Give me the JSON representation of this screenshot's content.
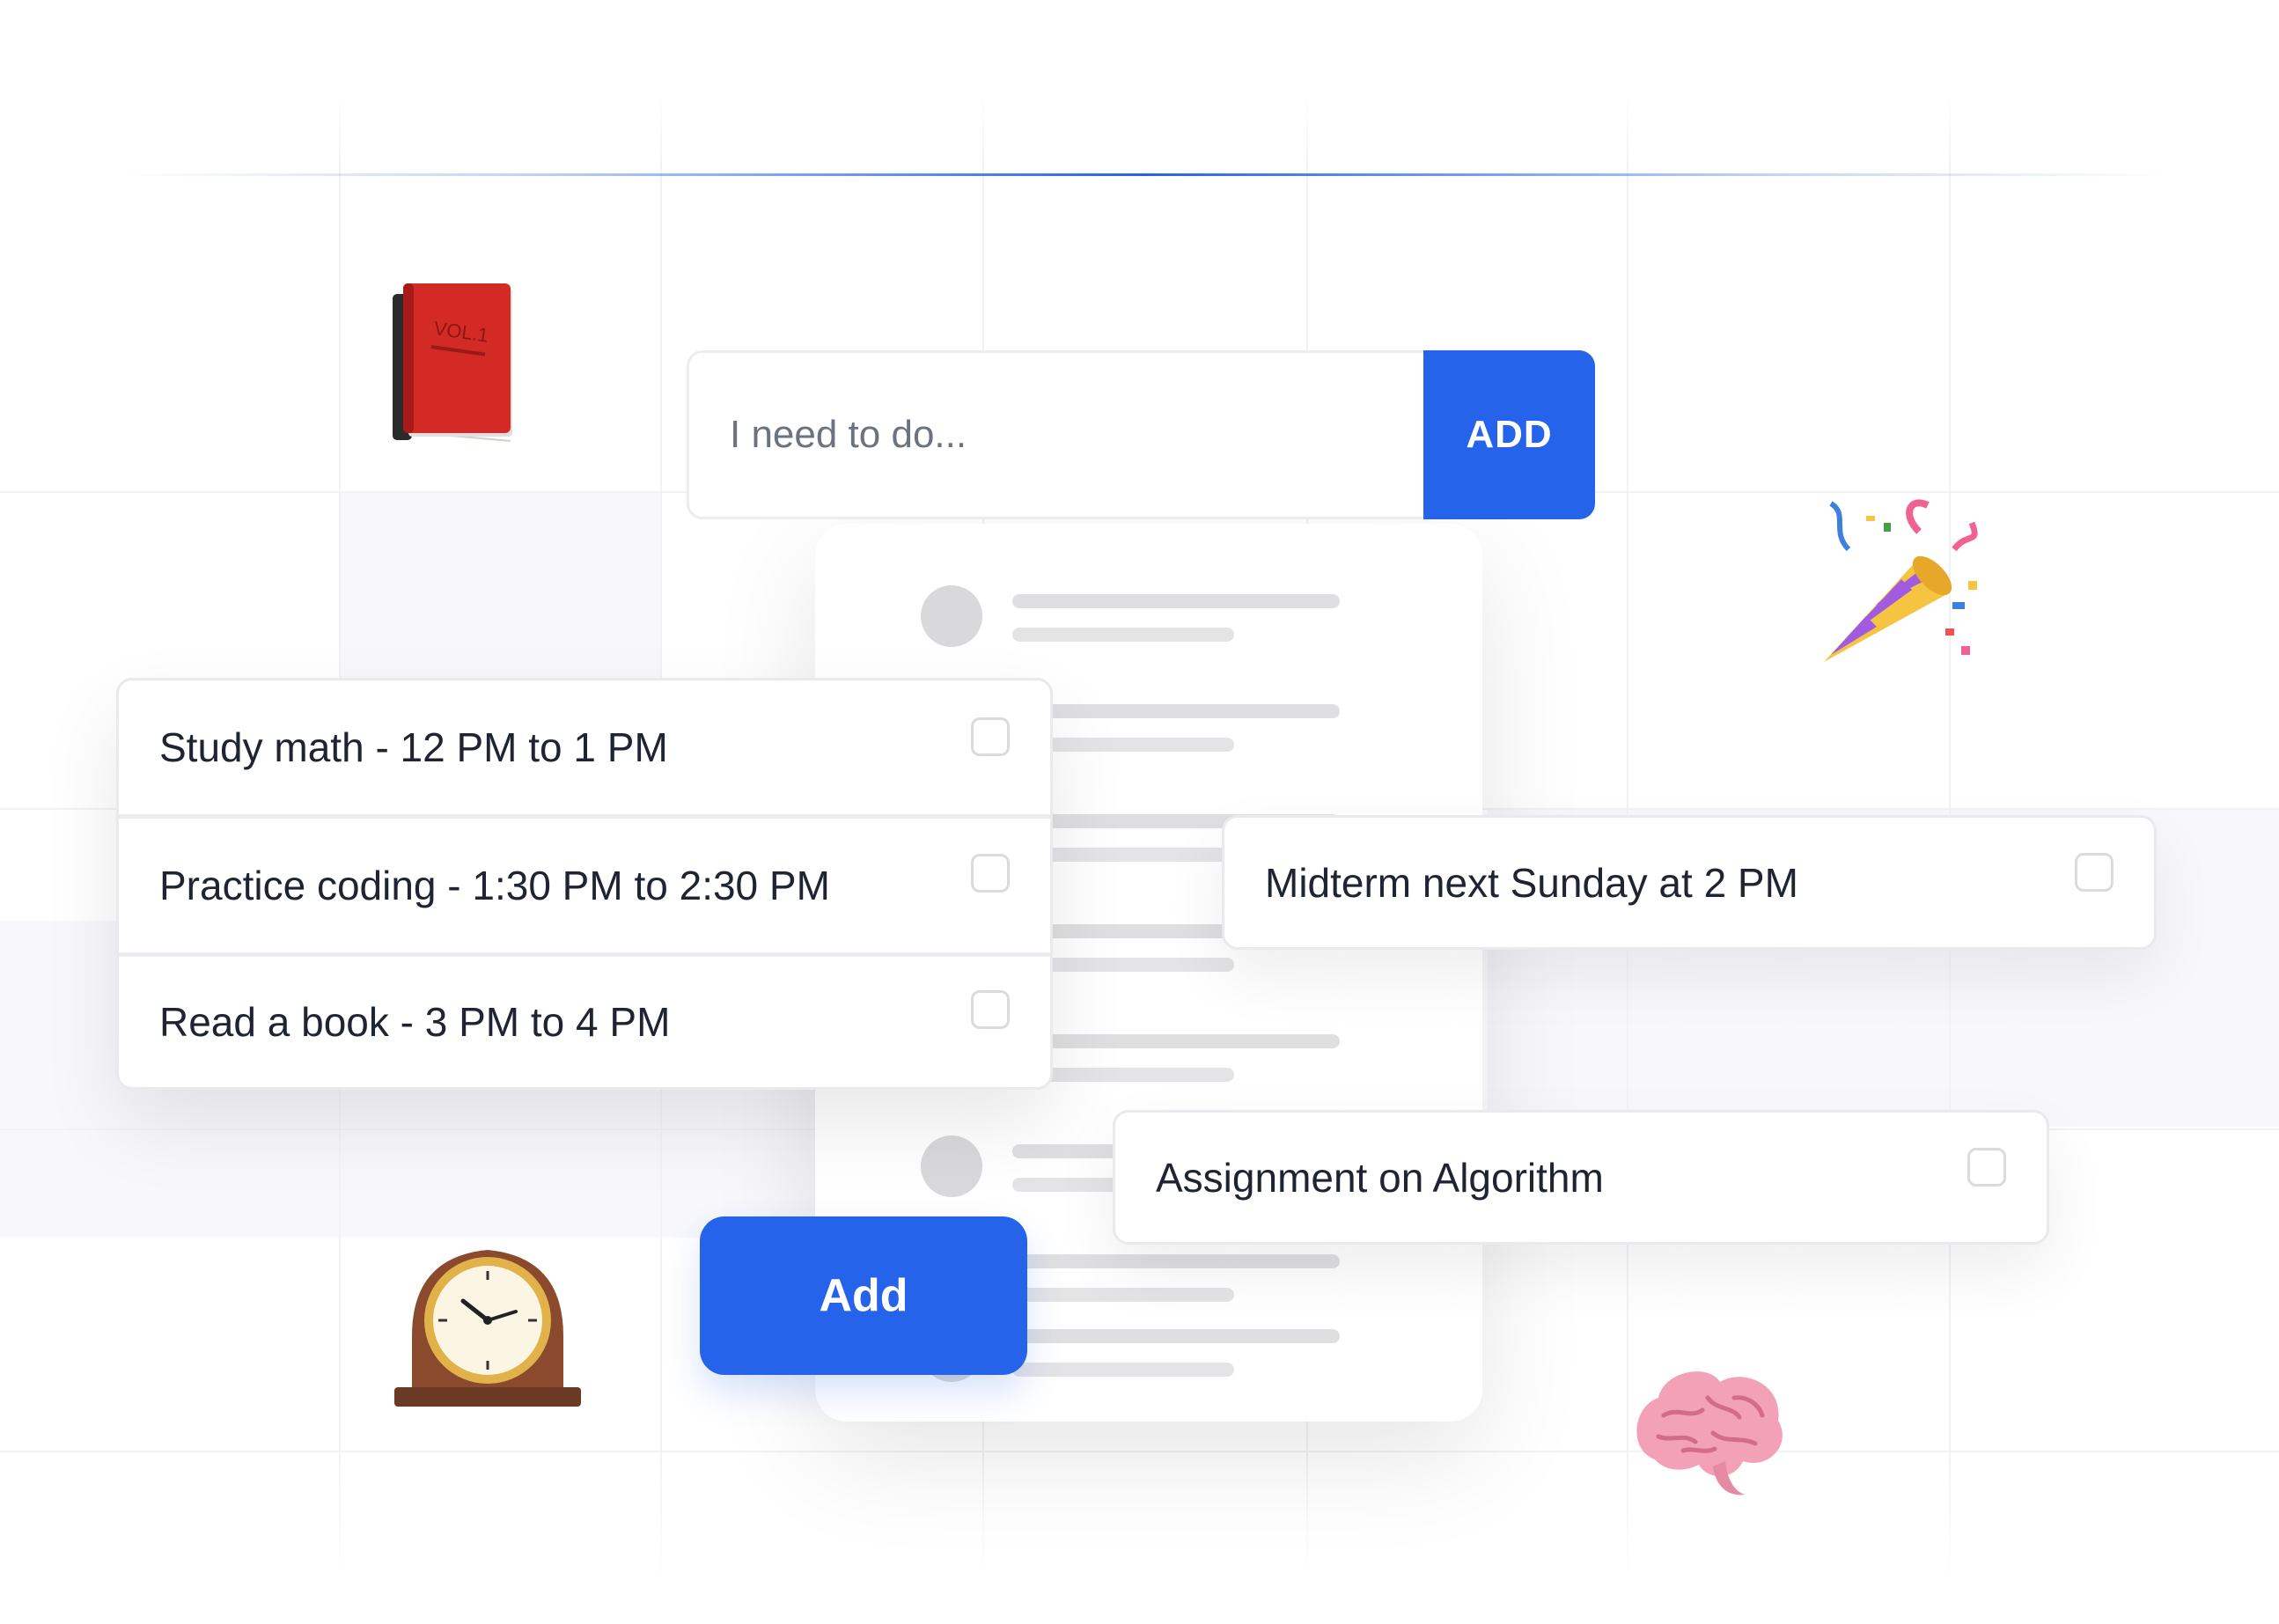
{
  "input": {
    "placeholder": "I need to do...",
    "add_label": "ADD"
  },
  "tasks": [
    {
      "text": "Study math - 12 PM to 1 PM",
      "checked": false
    },
    {
      "text": "Practice coding - 1:30 PM to 2:30 PM",
      "checked": false
    },
    {
      "text": "Read a book - 3 PM to 4 PM",
      "checked": false
    }
  ],
  "floating_tasks": [
    {
      "text": "Midterm next Sunday at 2 PM",
      "checked": false
    },
    {
      "text": "Assignment on Algorithm",
      "checked": false
    }
  ],
  "add_button": {
    "label": "Add"
  },
  "decorations": [
    "book-icon",
    "party-popper-icon",
    "mantelpiece-clock-icon",
    "brain-icon"
  ],
  "colors": {
    "accent": "#2563eb",
    "text": "#1f2433",
    "placeholder": "#6b7280",
    "border": "#e9e9ee"
  }
}
